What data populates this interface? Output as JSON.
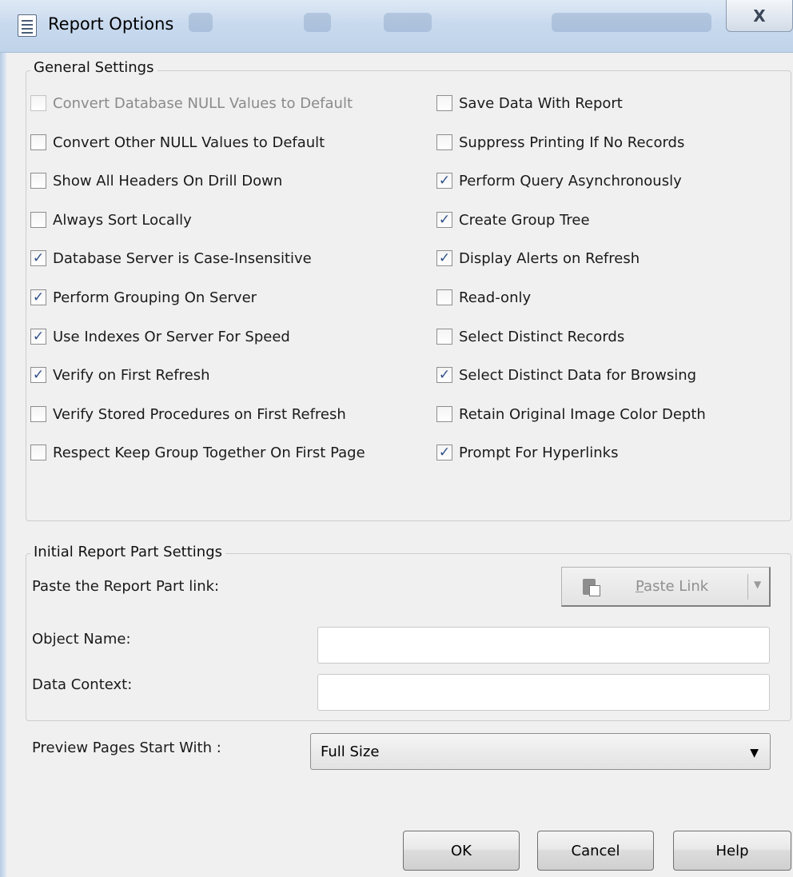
{
  "window": {
    "title": "Report Options",
    "close_label": "X"
  },
  "general_settings": {
    "label": "General Settings",
    "left_column": [
      {
        "label": "Convert Database NULL Values to Default",
        "checked": false,
        "disabled": true
      },
      {
        "label": "Convert Other NULL Values to Default",
        "checked": false,
        "disabled": false
      },
      {
        "label": "Show All Headers On Drill Down",
        "checked": false,
        "disabled": false
      },
      {
        "label": "Always Sort Locally",
        "checked": false,
        "disabled": false
      },
      {
        "label": "Database Server is Case-Insensitive",
        "checked": true,
        "disabled": false
      },
      {
        "label": "Perform Grouping On Server",
        "checked": true,
        "disabled": false
      },
      {
        "label": "Use Indexes Or Server For Speed",
        "checked": true,
        "disabled": false
      },
      {
        "label": "Verify on First Refresh",
        "checked": true,
        "disabled": false
      },
      {
        "label": "Verify Stored Procedures on First Refresh",
        "checked": false,
        "disabled": false
      },
      {
        "label": "Respect Keep Group Together On First Page",
        "checked": false,
        "disabled": false
      }
    ],
    "right_column": [
      {
        "label": "Save Data With Report",
        "checked": false,
        "disabled": false
      },
      {
        "label": "Suppress Printing If No Records",
        "checked": false,
        "disabled": false
      },
      {
        "label": "Perform Query Asynchronously",
        "checked": true,
        "disabled": false
      },
      {
        "label": "Create Group Tree",
        "checked": true,
        "disabled": false
      },
      {
        "label": "Display Alerts on Refresh",
        "checked": true,
        "disabled": false
      },
      {
        "label": "Read-only",
        "checked": false,
        "disabled": false
      },
      {
        "label": "Select Distinct Records",
        "checked": false,
        "disabled": false
      },
      {
        "label": "Select Distinct Data for Browsing",
        "checked": true,
        "disabled": false
      },
      {
        "label": "Retain Original Image Color Depth",
        "checked": false,
        "disabled": false
      },
      {
        "label": "Prompt For Hyperlinks",
        "checked": true,
        "disabled": false
      }
    ]
  },
  "initial_report_part": {
    "label": "Initial Report Part Settings",
    "paste_link_label": "Paste the Report Part link:",
    "paste_button_mnemonic": "P",
    "paste_button_rest": "aste Link",
    "object_name_label": "Object Name:",
    "object_name_value": "",
    "data_context_label": "Data Context:",
    "data_context_value": ""
  },
  "preview": {
    "label": "Preview Pages Start With :",
    "selected": "Full Size"
  },
  "buttons": {
    "ok": "OK",
    "cancel": "Cancel",
    "help": "Help"
  },
  "colors": {
    "check_mark": "#2f4f8a",
    "disabled_text": "#8a8a8a",
    "dialog_bg": "#f0f0f0"
  }
}
